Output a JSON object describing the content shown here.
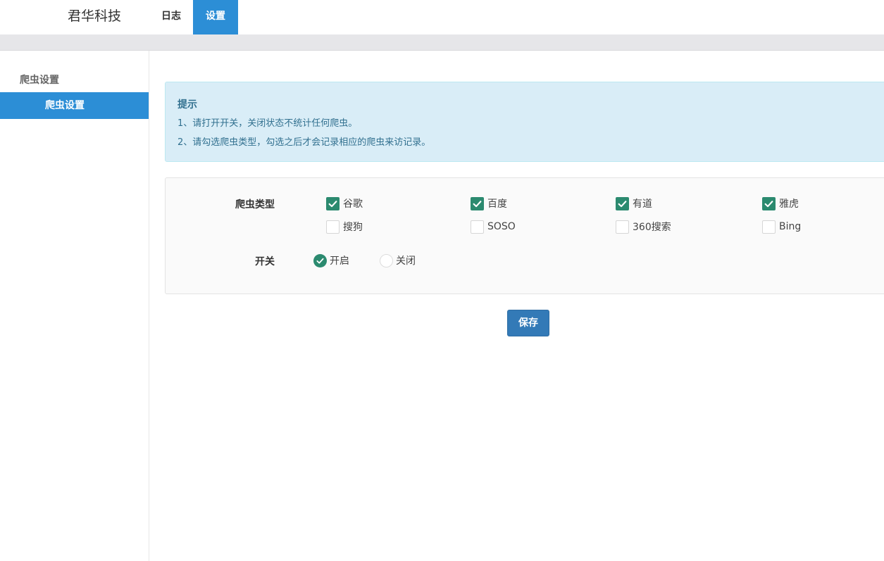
{
  "header": {
    "brand": "君华科技",
    "tabs": [
      {
        "label": "日志",
        "active": false
      },
      {
        "label": "设置",
        "active": true
      }
    ]
  },
  "sidebar": {
    "group_label": "爬虫设置",
    "items": [
      {
        "label": "爬虫设置",
        "active": true
      }
    ]
  },
  "alert": {
    "title": "提示",
    "lines": [
      "1、请打开开关，关闭状态不统计任何爬虫。",
      "2、请勾选爬虫类型，勾选之后才会记录相应的爬虫来访记录。"
    ]
  },
  "form": {
    "crawler_type_label": "爬虫类型",
    "crawlers": [
      {
        "label": "谷歌",
        "checked": true
      },
      {
        "label": "百度",
        "checked": true
      },
      {
        "label": "有道",
        "checked": true
      },
      {
        "label": "雅虎",
        "checked": true
      },
      {
        "label": "搜狗",
        "checked": false
      },
      {
        "label": "SOSO",
        "checked": false
      },
      {
        "label": "360搜索",
        "checked": false
      },
      {
        "label": "Bing",
        "checked": false
      }
    ],
    "switch_label": "开关",
    "switch_options": [
      {
        "label": "开启",
        "selected": true
      },
      {
        "label": "关闭",
        "selected": false
      }
    ],
    "save_label": "保存"
  },
  "colors": {
    "primary_blue": "#2c8ed6",
    "check_green": "#2b8a6f",
    "alert_bg": "#d9edf7",
    "alert_text": "#31708f",
    "button_blue": "#337ab7"
  }
}
